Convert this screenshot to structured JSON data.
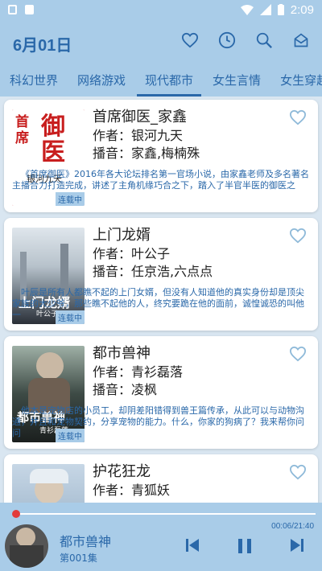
{
  "status_bar": {
    "time": "2:09"
  },
  "header": {
    "date": "6月01日",
    "icons": [
      "heart-icon",
      "history-icon",
      "search-icon",
      "mail-icon"
    ]
  },
  "tabs": [
    {
      "label": "科幻世界",
      "active": false
    },
    {
      "label": "网络游戏",
      "active": false
    },
    {
      "label": "现代都市",
      "active": true
    },
    {
      "label": "女生言情",
      "active": false
    },
    {
      "label": "女生穿越",
      "active": false
    }
  ],
  "books": [
    {
      "title": "首席御医_家鑫",
      "author": "作者：银河九天",
      "narrator": "播音：家鑫,梅楠殊",
      "status": "连载中",
      "description": "《首席御医》2016年各大论坛排名第一官场小说，由家鑫老师及多名著名主播合力打造完成，讲述了主角机缘巧合之下，踏入了半官半医的御医之",
      "cover_text": [
        "首",
        "席",
        "御",
        "医",
        "银河九天"
      ]
    },
    {
      "title": "上门龙婿",
      "author": "作者：叶公子",
      "narrator": "播音：任京浩,六点点",
      "status": "连载中",
      "description": "叶辰是所有人都瞧不起的上门女婿，但没有人知道他的真实身份却是顶尖家族的大少爷，那些瞧不起他的人，终究要跪在他的面前，诚惶诚恐的叫他一",
      "cover_text": [
        "上门龙婿",
        "叶公子"
      ]
    },
    {
      "title": "都市兽神",
      "author": "作者：青衫磊落",
      "narrator": "播音：凌枫",
      "status": "连载中",
      "description": "他本是宠物店的小员工，却阴差阳错得到兽王篇传承，从此可以与动物沟通，并且和宠物契约，分享宠物的能力。什么，你家的狗病了？我来帮你问问",
      "cover_text": [
        "都市兽神",
        "青衫磊落"
      ]
    },
    {
      "title": "护花狂龙",
      "author": "作者：青狐妖",
      "narrator": "",
      "status": "",
      "description": "",
      "cover_text": []
    }
  ],
  "player": {
    "title": "都市兽神",
    "episode": "第001集",
    "time": "00:06/21:40",
    "progress": 0.005
  },
  "colors": {
    "accent": "#2a68a9",
    "header_bg": "#a9cce8",
    "page_bg": "#d9e6f1",
    "progress": "#e23b3b"
  }
}
